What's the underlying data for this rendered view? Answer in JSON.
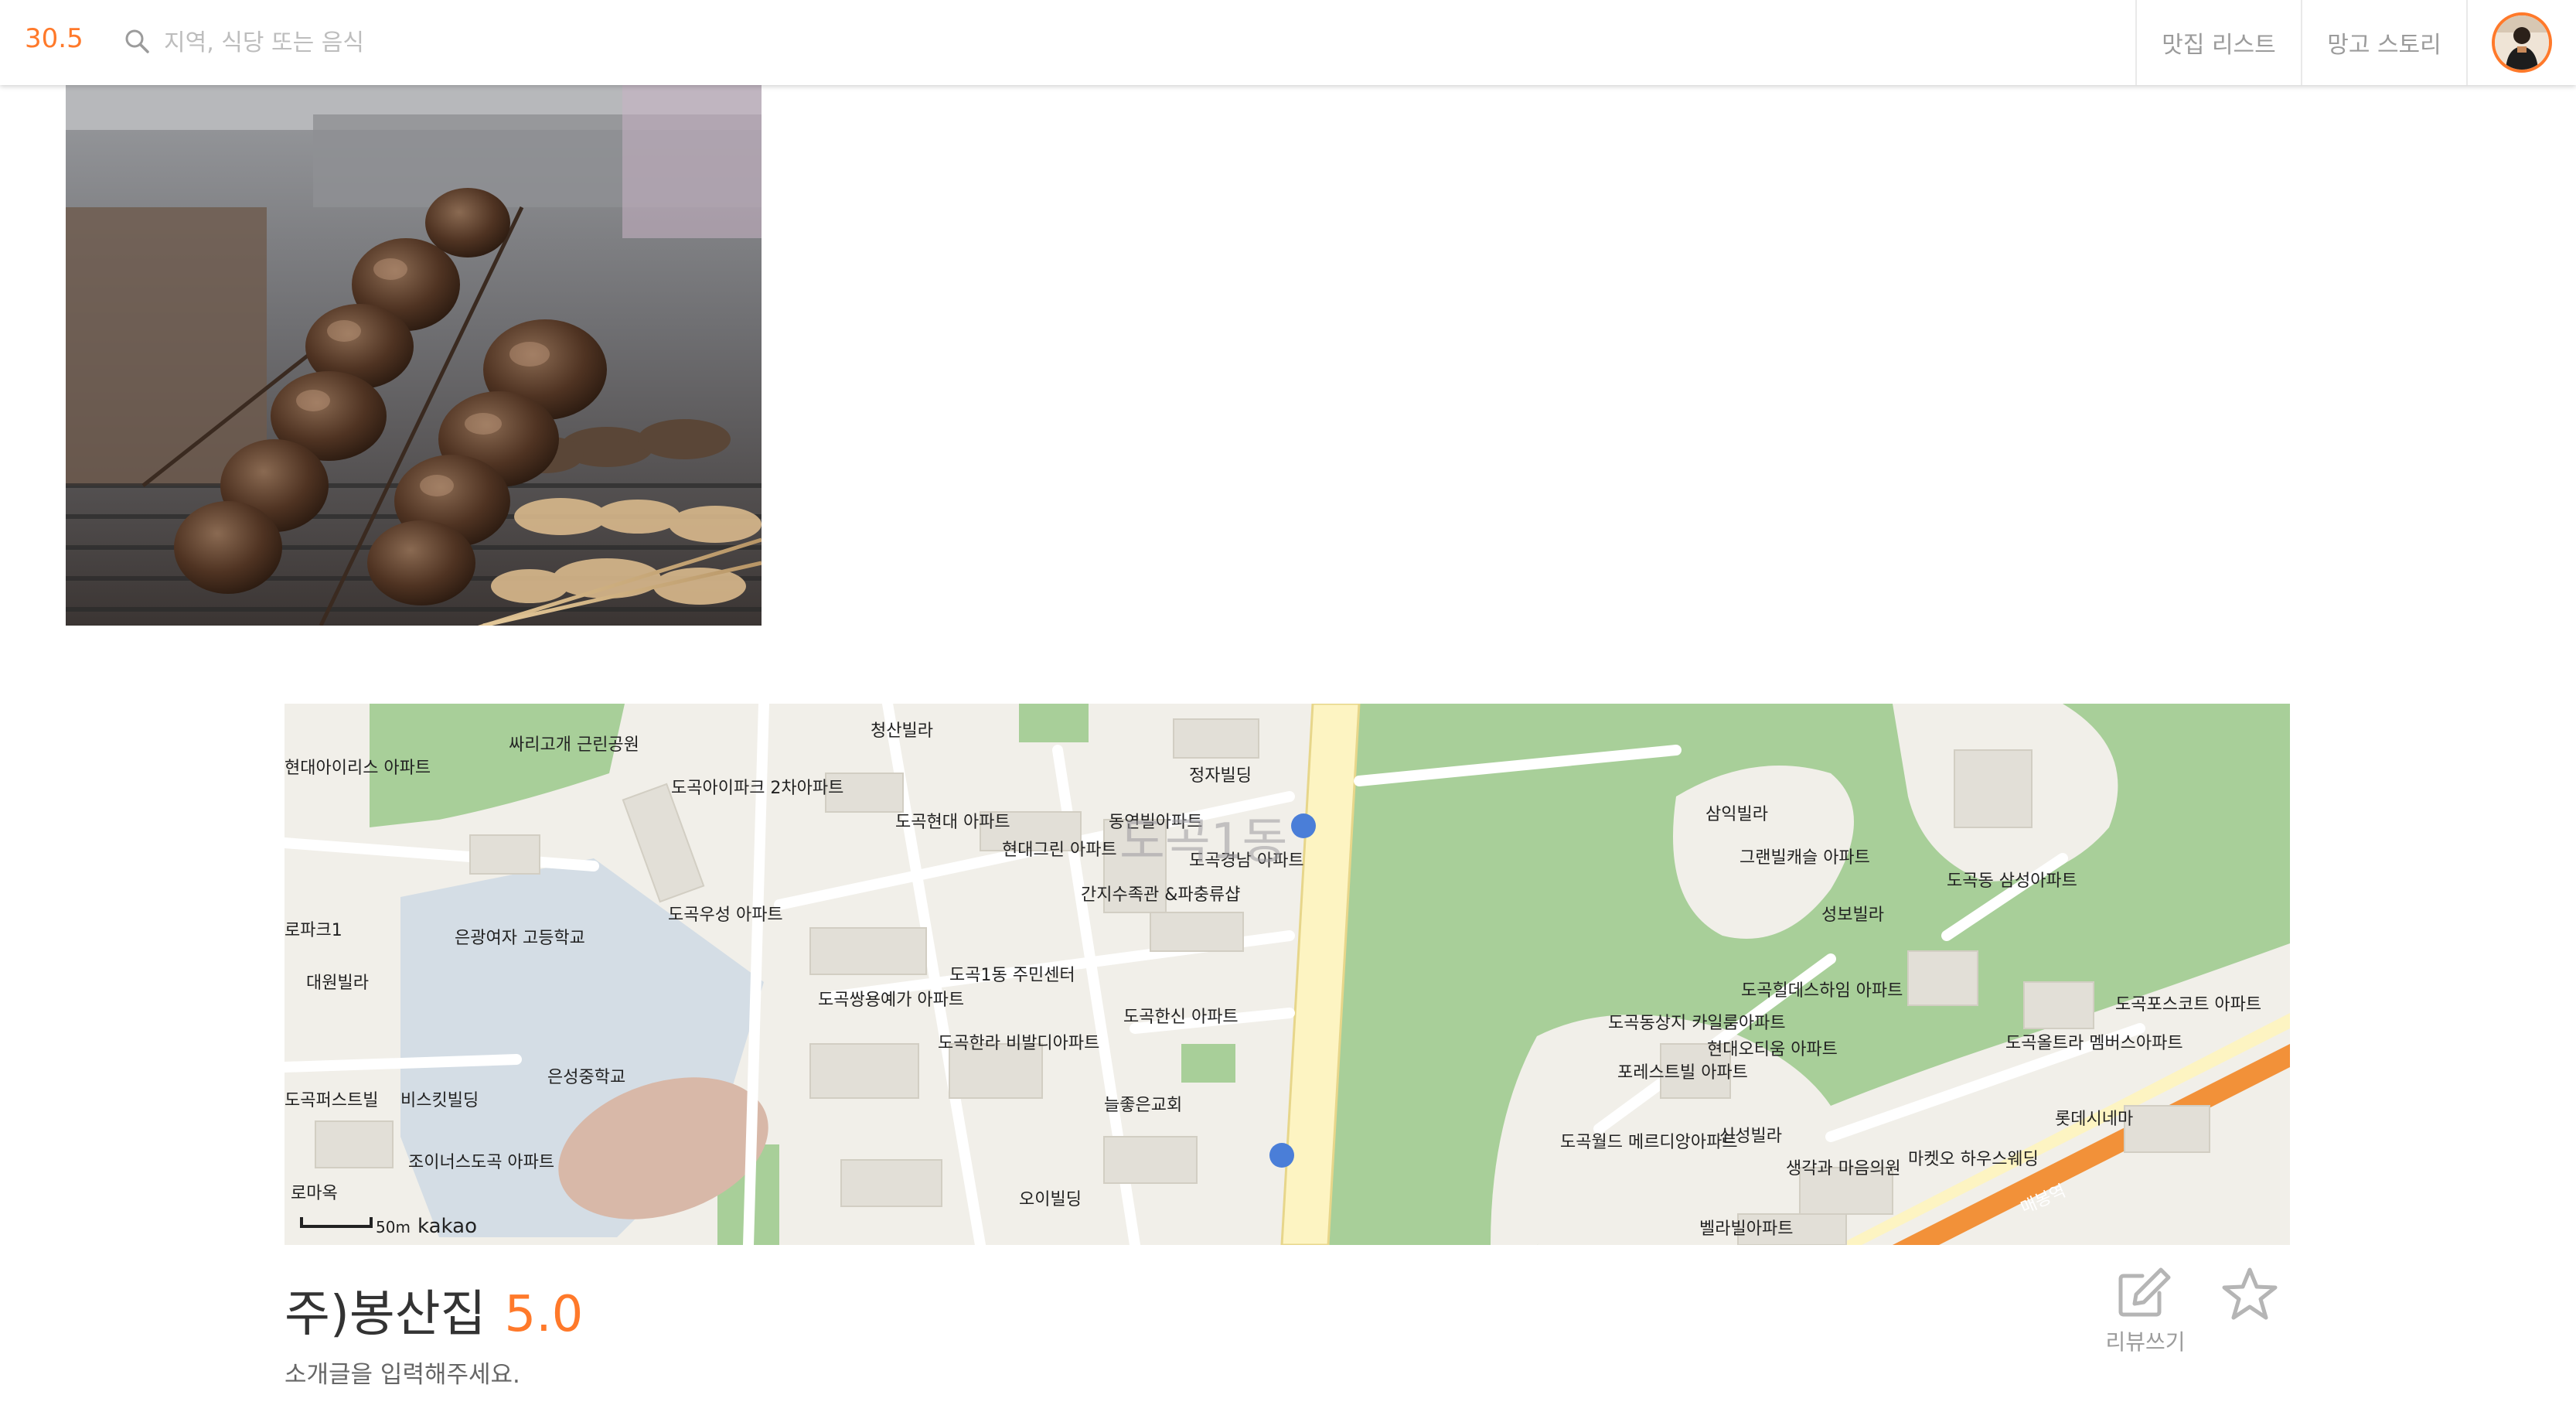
{
  "header": {
    "logo": "30.5",
    "search_placeholder": "지역, 식당 또는 음식",
    "nav": {
      "list_label": "맛집 리스트",
      "story_label": "망고 스토리"
    }
  },
  "restaurant": {
    "name": "주)봉산집",
    "score": "5.0",
    "intro": "소개글을 입력해주세요."
  },
  "actions": {
    "review_label": "리뷰쓰기"
  },
  "map": {
    "scale_label": "50m",
    "provider": "kakao",
    "district_label": "도곡1동",
    "labels": {
      "a": "청산빌라",
      "b": "정자빌딩",
      "c": "동연빌아파트",
      "d": "도곡아이파크 2차아파트",
      "e": "도곡현대 아파트",
      "f": "현대그린 아파트",
      "g": "도곡경남 아파트",
      "h": "간지수족관 &파충류샵",
      "i": "싸리고개 근린공원",
      "j": "현대아이리스 아파트",
      "k": "은광여자 고등학교",
      "l": "은성중학교",
      "m": "도곡우성 아파트",
      "n": "도곡1동 주민센터",
      "o": "도곡쌍용예가 아파트",
      "p": "도곡한라 비발디아파트",
      "q": "도곡한신 아파트",
      "r": "늘좋은교회",
      "s": "오이빌딩",
      "t": "비스킷빌딩",
      "u": "조이너스도곡 아파트",
      "v": "삼익빌라",
      "w": "그랜빌캐슬 아파트",
      "x": "성보빌라",
      "y": "도곡동 삼성아파트",
      "z": "도곡힐데스하임 아파트",
      "aa": "도곡포스코트 아파트",
      "ab": "도곡동상지 카일룸아파트",
      "ac": "현대오티움 아파트",
      "ad": "도곡올트라 멤버스아파트",
      "ae": "포레스트빌 아파트",
      "af": "롯데시네마",
      "ag": "도곡월드 메르디앙아파트",
      "ah": "신성빌라",
      "ai": "생각과 마음의원",
      "aj": "마켓오 하우스웨딩",
      "ak": "벨라빌아파트",
      "al": "매봉역",
      "am": "대원빌라",
      "an": "도곡퍼스트빌",
      "ao": "로파크1",
      "ap": "로마옥"
    }
  },
  "colors": {
    "accent": "#ff792a",
    "text_dark": "#333333",
    "text_muted": "#9b9b9b",
    "park": "#a8cf99",
    "road": "#fdf4c2"
  }
}
